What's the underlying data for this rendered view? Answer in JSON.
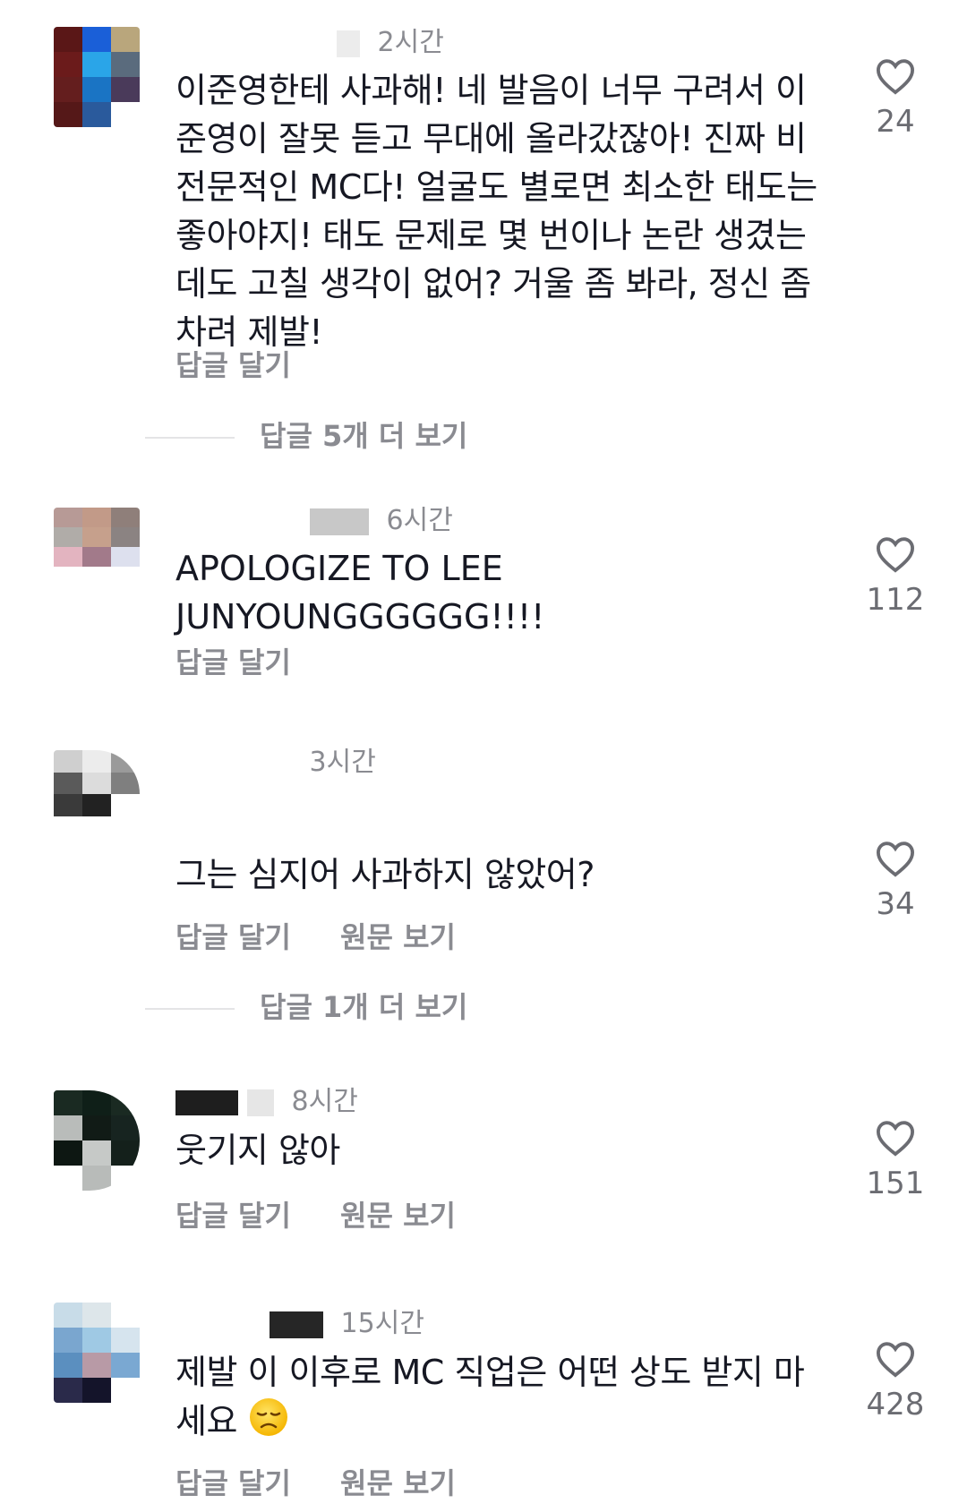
{
  "comments": [
    {
      "time": "2시간",
      "text": "이준영한테 사과해! 네 발음이 너무 구려서 이준영이 잘못 듣고 무대에 올라갔잖아! 진짜 비전문적인 MC다! 얼굴도 별로면 최소한 태도는 좋아야지! 태도 문제로 몇 번이나 논란 생겼는데도 고칠 생각이 없어? 거울 좀 봐라, 정신 좀 차려 제발!",
      "reply": "답글 달기",
      "likes": "24",
      "more_replies": "답글 5개 더 보기"
    },
    {
      "time": "6시간",
      "text": "APOLOGIZE TO LEE JUNYOUNGGGGGG!!!!",
      "reply": "답글 달기",
      "likes": "112"
    },
    {
      "time": "3시간",
      "text": "그는 심지어 사과하지 않았어?",
      "reply": "답글 달기",
      "original": "원문 보기",
      "likes": "34",
      "more_replies": "답글 1개 더 보기"
    },
    {
      "time": "8시간",
      "text": "웃기지 않아",
      "reply": "답글 달기",
      "original": "원문 보기",
      "likes": "151"
    },
    {
      "time": "15시간",
      "text": "제발 이 이후로 MC 직업은 어떤 상도 받지 마세요",
      "emoji": "disappointed-face",
      "reply": "답글 달기",
      "original": "원문 보기",
      "likes": "428"
    }
  ],
  "colors": {
    "secondary_text": "#8a8b91",
    "primary_text": "#161823",
    "like_icon": "#6b6c72"
  }
}
